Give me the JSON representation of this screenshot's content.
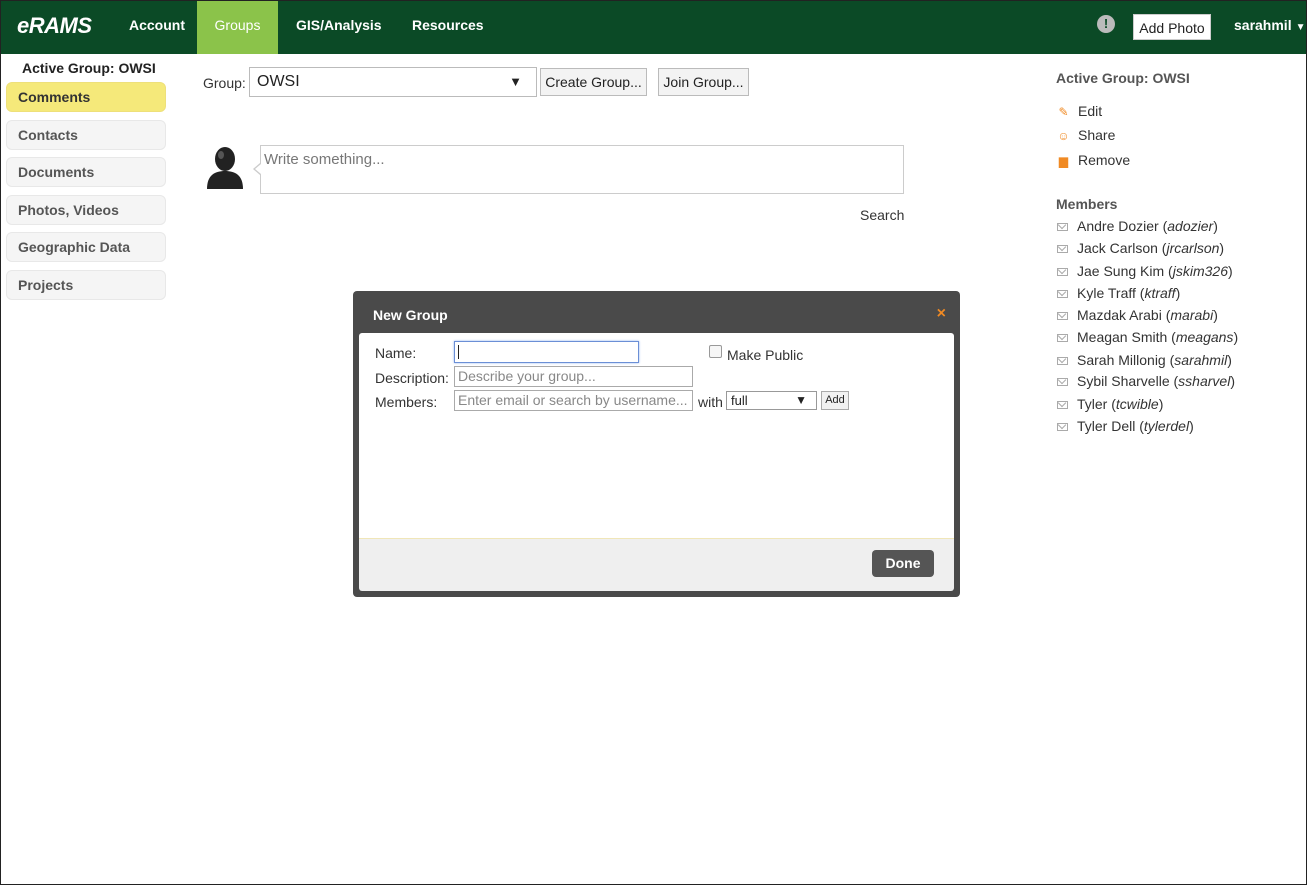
{
  "nav": {
    "brand": "eRAMS",
    "items": [
      {
        "label": "Account"
      },
      {
        "label": "Groups"
      },
      {
        "label": "GIS/Analysis"
      },
      {
        "label": "Resources"
      }
    ],
    "alert": "!",
    "add_photo": "Add Photo",
    "user": "sarahmil",
    "active_color": "#8bc34a",
    "bar_color": "#0b4a26"
  },
  "sidebar": {
    "active_group_label": "Active Group: OWSI",
    "items": [
      {
        "label": "Comments"
      },
      {
        "label": "Contacts"
      },
      {
        "label": "Documents"
      },
      {
        "label": "Photos, Videos"
      },
      {
        "label": "Geographic Data"
      },
      {
        "label": "Projects"
      }
    ]
  },
  "main": {
    "group_label": "Group:",
    "group_value": "OWSI",
    "create_group": "Create Group...",
    "join_group": "Join Group...",
    "post_placeholder": "Write something...",
    "search": "Search"
  },
  "right": {
    "title": "Active Group: OWSI",
    "actions": [
      {
        "label": "Edit",
        "icon": "pencil-icon"
      },
      {
        "label": "Share",
        "icon": "user-icon"
      },
      {
        "label": "Remove",
        "icon": "trash-icon"
      }
    ],
    "members_title": "Members",
    "members": [
      {
        "name": "Andre Dozier",
        "username": "adozier"
      },
      {
        "name": "Jack Carlson",
        "username": "jrcarlson"
      },
      {
        "name": "Jae Sung Kim",
        "username": "jskim326"
      },
      {
        "name": "Kyle Traff",
        "username": "ktraff"
      },
      {
        "name": "Mazdak Arabi",
        "username": "marabi"
      },
      {
        "name": "Meagan Smith",
        "username": "meagans"
      },
      {
        "name": "Sarah Millonig",
        "username": "sarahmil"
      },
      {
        "name": "Sybil Sharvelle",
        "username": "ssharvel"
      },
      {
        "name": "Tyler",
        "username": "tcwible"
      },
      {
        "name": "Tyler Dell",
        "username": "tylerdel"
      }
    ]
  },
  "modal": {
    "title": "New Group",
    "close": "×",
    "name_label": "Name:",
    "name_value": "",
    "make_public": "Make Public",
    "description_label": "Description:",
    "description_placeholder": "Describe your group...",
    "members_label": "Members:",
    "members_placeholder": "Enter email or search by username...",
    "with": "with",
    "permission": "full",
    "add": "Add",
    "done": "Done"
  }
}
